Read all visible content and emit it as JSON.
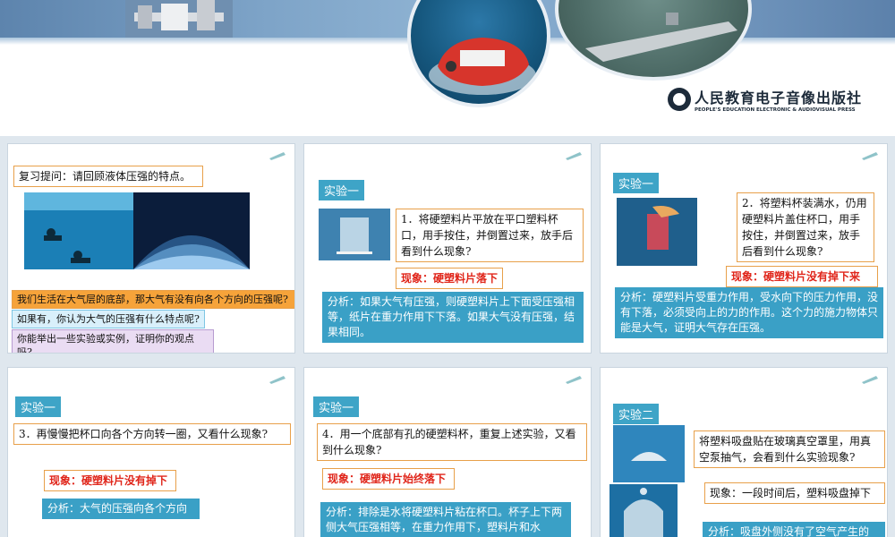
{
  "banner": {
    "publisher_cn": "人民教育电子音像出版社",
    "publisher_en": "PEOPLE'S EDUCATION ELECTRONIC & AUDIOVISUAL PRESS"
  },
  "slide1": {
    "question": "复习提问：请回顾液体压强的特点。",
    "q1": "我们生活在大气层的底部，那大气有没有向各个方向的压强呢?",
    "q2": "如果有，你认为大气的压强有什么特点呢?",
    "q3": "你能举出一些实验或实例，证明你的观点吗?"
  },
  "slide2": {
    "tag": "实验一",
    "step": "1．将硬塑料片平放在平口塑料杯口，用手按住，并倒置过来，放手后看到什么现象?",
    "result": "现象：硬塑料片落下",
    "analysis": "分析：如果大气有压强，则硬塑料片上下面受压强相等，纸片在重力作用下下落。如果大气没有压强，结果相同。"
  },
  "slide3": {
    "tag": "实验一",
    "step": "2．将塑料杯装满水，仍用硬塑料片盖住杯口，用手按住，并倒置过来，放手后看到什么现象?",
    "result": "现象：硬塑料片没有掉下来",
    "analysis": "分析：硬塑料片受重力作用，受水向下的压力作用，没有下落，必须受向上的力的作用。这个力的施力物体只能是大气，证明大气存在压强。"
  },
  "slide4": {
    "tag": "实验一",
    "step": "3．再慢慢把杯口向各个方向转一圈，又看什么现象?",
    "result": "现象：硬塑料片没有掉下",
    "analysis": "分析：大气的压强向各个方向"
  },
  "slide5": {
    "tag": "实验一",
    "step": "4．用一个底部有孔的硬塑料杯，重复上述实验，又看到什么现象?",
    "result": "现象：硬塑料片始终落下",
    "analysis": "分析：排除是水将硬塑料片粘在杯口。杯子上下两侧大气压强相等，在重力作用下，塑料片和水"
  },
  "slide6": {
    "tag": "实验二",
    "step": "将塑料吸盘贴在玻璃真空罩里，用真空泵抽气，会看到什么实验现象?",
    "result": "现象：一段时间后，塑料吸盘掉下",
    "analysis": "分析：吸盘外侧没有了空气产生的"
  }
}
